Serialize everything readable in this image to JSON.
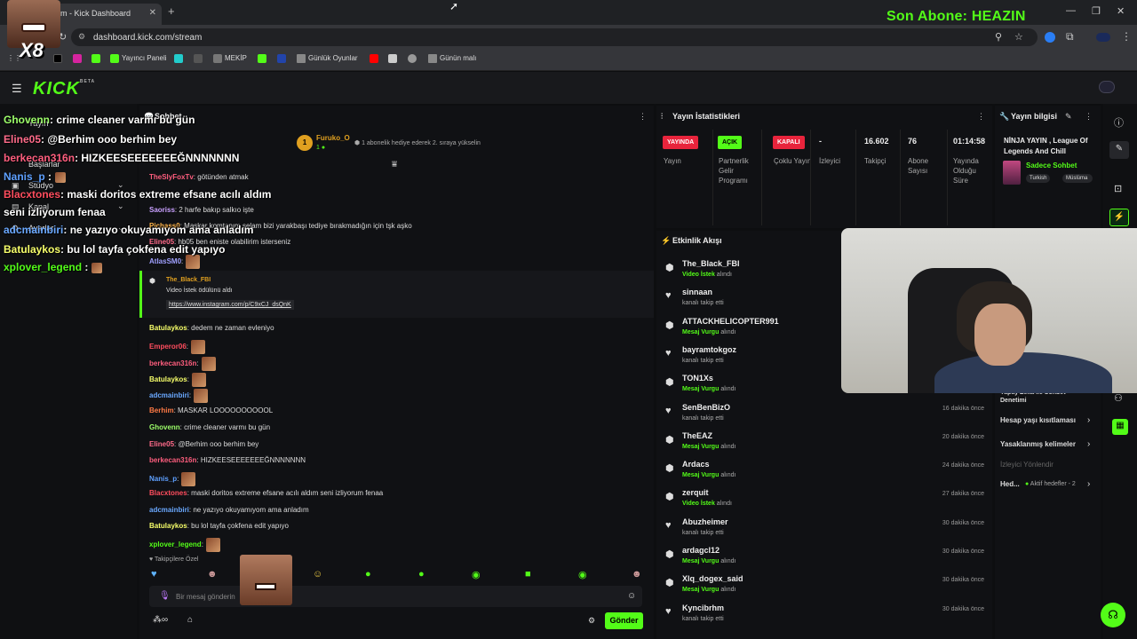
{
  "browser": {
    "tab_title": "m - Kick Dashboard",
    "tab_close": "✕",
    "new_tab": "+",
    "url": "dashboard.kick.com/stream",
    "bookmarks": [
      "Yayıncı Paneli",
      "MEKİP",
      "Günlük Oyunlar",
      "Günün malı"
    ],
    "win_minimize": "—",
    "win_restore": "❐",
    "win_close": "✕"
  },
  "overlay": {
    "last_sub": "Son Abone: HEAZIN",
    "x8": "X8",
    "messages": [
      {
        "user": "Ghovenn",
        "text": ": crime cleaner varmı bu gün",
        "color": "#9dff6a"
      },
      {
        "user": "Eline05",
        "text": ": @Berhim ooo berhim bey",
        "color": "#ff6b8a"
      },
      {
        "user": "berkecan316n",
        "text": ": HIZKEESEEEEEEEĞNNNNNNN",
        "color": "#ff5e7e"
      },
      {
        "user": "Nanis_p",
        "text": " :",
        "color": "#5ea0ff"
      },
      {
        "user": "Blacxtones",
        "text": ": maski doritos extreme efsane acılı aldım",
        "color": "#ff4d5e"
      },
      {
        "user": "",
        "text": "seni izliyorum fenaa",
        "color": "#fff"
      },
      {
        "user": "adcmainbiri",
        "text": ": ne yazıyo okuyamıyom ama anladım",
        "color": "#6aa8ff"
      },
      {
        "user": "Batulaykos",
        "text": ": bu lol tayfa çokfena edit yapıyo",
        "color": "#f7ff6a"
      },
      {
        "user": "xplover_legend",
        "text": " :",
        "color": "#53fc18"
      }
    ]
  },
  "kick": {
    "logo": "KICK",
    "beta": "BETA",
    "sidebar": [
      "Yayın",
      "Başlarlar",
      "Stüdyo",
      "Kanal",
      "Ayarlar"
    ]
  },
  "chat": {
    "title": "Sohbet",
    "gift_user": "Furuko_O",
    "gift_count": "1",
    "gift_text": "1 abonelik hediye ederek 2. sıraya yükselin",
    "messages": [
      {
        "user": "TheSlyFoxTv",
        "text": ": götünden atmak",
        "color": "#ff5e7e"
      },
      {
        "user": "Saoriss",
        "text": ": 2 harfe bakıp salkıo işte",
        "color": "#c9a0ff"
      },
      {
        "user": "Pichass0",
        "text": ": Maskar komtanım selam bizi yarakbaşı tediye bırakmadığın için tşk aşko",
        "color": "#ffb347"
      },
      {
        "user": "Eline05",
        "text": ": hb05 ben eniste olabilirim isterseniz",
        "color": "#ff6b8a"
      },
      {
        "user": "AtlasSM0",
        "text": ":",
        "color": "#a0a0ff"
      }
    ],
    "pinned_user": "The_Black_FBI",
    "pinned_text": "Video İstek ödülünü aldı",
    "pinned_link": "https://www.instagram.com/p/C9xCJ_dsQnK",
    "messages2": [
      {
        "user": "Batulaykos",
        "text": ": dedem ne zaman evleniyo",
        "color": "#f7ff6a"
      },
      {
        "user": "Emperor06",
        "text": ":",
        "color": "#ff4d5e"
      },
      {
        "user": "berkecan316n",
        "text": ":",
        "color": "#ff5e7e"
      },
      {
        "user": "Batulaykos",
        "text": ":",
        "color": "#f7ff6a"
      },
      {
        "user": "adcmainbiri",
        "text": ":",
        "color": "#6aa8ff"
      },
      {
        "user": "Berhim",
        "text": ": MASKAR LOOOOOOOOOOL",
        "color": "#ff7a45"
      },
      {
        "user": "Ghovenn",
        "text": ": crime cleaner varmı bu gün",
        "color": "#9dff6a"
      },
      {
        "user": "Eline05",
        "text": ": @Berhim ooo berhim bey",
        "color": "#ff6b8a"
      },
      {
        "user": "berkecan316n",
        "text": ": HIZKEESEEEEEEEĞNNNNNNN",
        "color": "#ff5e7e"
      },
      {
        "user": "Nanis_p",
        "text": ":",
        "color": "#5ea0ff"
      },
      {
        "user": "Blacxtones",
        "text": ": maski doritos extreme efsane acılı aldım seni izliyorum fenaa",
        "color": "#ff4d5e"
      },
      {
        "user": "adcmainbiri",
        "text": ": ne yazıyo okuyamıyom ama anladım",
        "color": "#6aa8ff"
      },
      {
        "user": "Batulaykos",
        "text": ": bu lol tayfa çokfena edit yapıyo",
        "color": "#f7ff6a"
      },
      {
        "user": "xplover_legend",
        "text": ":",
        "color": "#53fc18"
      }
    ],
    "followers_only": "Takipçilere Özel",
    "input_placeholder": "Bir mesaj gönderin",
    "send": "Gönder"
  },
  "stats": {
    "title": "Yayın İstatistikleri",
    "badges": [
      {
        "label": "YAYINDA",
        "caption": "Yayın",
        "bg": "#e8243c",
        "fg": "#fff"
      },
      {
        "label": "AÇIK",
        "caption": "Partnerlik Gelir Programı",
        "bg": "#53fc18",
        "fg": "#000"
      },
      {
        "label": "KAPALI",
        "caption": "Çoklu Yayın",
        "bg": "#e8243c",
        "fg": "#fff"
      }
    ],
    "values": [
      {
        "value": "-",
        "caption": "İzleyici"
      },
      {
        "value": "16.602",
        "caption": "Takipçi"
      },
      {
        "value": "76",
        "caption": "Abone Sayısı"
      },
      {
        "value": "01:14:58",
        "caption": "Yayında Olduğu Süre"
      }
    ]
  },
  "activity": {
    "title": "Etkinlik Akışı",
    "items": [
      {
        "user": "The_Black_FBI",
        "action": "Video İstek",
        "suffix": " alındı",
        "type": "reward",
        "time": ""
      },
      {
        "user": "sinnaan",
        "action": "",
        "suffix": "kanalı takip etti",
        "type": "follow",
        "time": ""
      },
      {
        "user": "ATTACKHELICOPTER991",
        "action": "Mesaj Vurgu",
        "suffix": " alındı",
        "type": "reward",
        "time": ""
      },
      {
        "user": "bayramtokgoz",
        "action": "",
        "suffix": "kanalı takip etti",
        "type": "follow",
        "time": ""
      },
      {
        "user": "TON1Xs",
        "action": "Mesaj Vurgu",
        "suffix": " alındı",
        "type": "reward",
        "time": ""
      },
      {
        "user": "SenBenBizO",
        "action": "",
        "suffix": "kanalı takip etti",
        "type": "follow",
        "time": "16 dakika önce"
      },
      {
        "user": "TheEAZ",
        "action": "Mesaj Vurgu",
        "suffix": " alındı",
        "type": "reward",
        "time": "20 dakika önce"
      },
      {
        "user": "Ardacs",
        "action": "Mesaj Vurgu",
        "suffix": " alındı",
        "type": "reward",
        "time": "24 dakika önce"
      },
      {
        "user": "zerquit",
        "action": "Video İstek",
        "suffix": " alındı",
        "type": "reward",
        "time": "27 dakika önce"
      },
      {
        "user": "Abuzheimer",
        "action": "",
        "suffix": "kanalı takip etti",
        "type": "follow",
        "time": "30 dakika önce"
      },
      {
        "user": "ardagcl12",
        "action": "Mesaj Vurgu",
        "suffix": " alındı",
        "type": "reward",
        "time": "30 dakika önce"
      },
      {
        "user": "Xlq_dogex_said",
        "action": "Mesaj Vurgu",
        "suffix": " alındı",
        "type": "reward",
        "time": "30 dakika önce"
      },
      {
        "user": "Kyncibrhm",
        "action": "",
        "suffix": "kanalı takip etti",
        "type": "follow",
        "time": "30 dakika önce"
      }
    ]
  },
  "info": {
    "title": "Yayın bilgisi",
    "stream_title": "NİNJA YAYIN , League Of Legends And Chill",
    "category": "Sadece Sohbet",
    "tags": [
      "Turkish",
      "Müslüma"
    ],
    "links": [
      "Yapay Zeka ile Sohbet Denetimi",
      "Hesap yaşı kısıtlaması",
      "Yasaklanmış kelimeler"
    ],
    "viewer_redirect": "İzleyici Yönlendir",
    "goals_label": "Hed...",
    "goals_value": "Aktif hedefler - 2"
  },
  "colors": {
    "accent": "#53fc18",
    "live": "#e8243c"
  }
}
